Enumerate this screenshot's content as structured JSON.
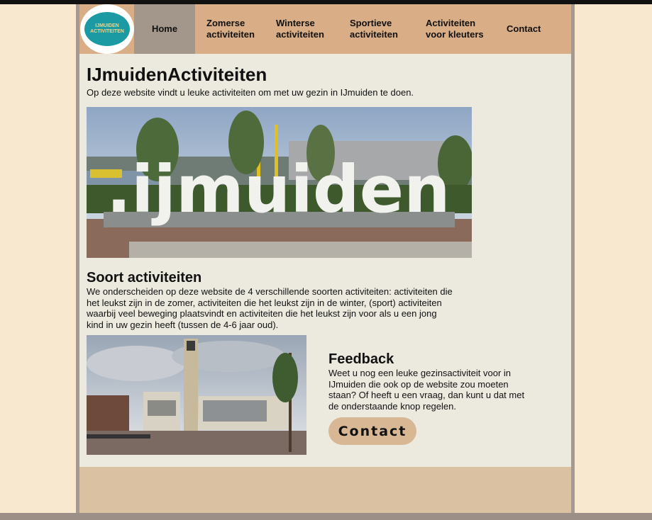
{
  "logo": {
    "line1": "IJMUIDEN",
    "line2": "ACTIVITEITEN"
  },
  "nav": {
    "items": [
      {
        "line1": "Home",
        "line2": ""
      },
      {
        "line1": "Zomerse",
        "line2": "activiteiten"
      },
      {
        "line1": "Winterse",
        "line2": "activiteiten"
      },
      {
        "line1": "Sportieve",
        "line2": "activiteiten"
      },
      {
        "line1": "Activiteiten",
        "line2": "voor kleuters"
      },
      {
        "line1": "Contact",
        "line2": ""
      }
    ]
  },
  "page": {
    "title": "IJmuidenActiviteiten",
    "intro": "Op deze website vindt u leuke activiteiten om met uw gezin in IJmuiden te doen.",
    "hero_sign": ".ijmuiden"
  },
  "section": {
    "title": "Soort activiteiten",
    "text": "We onderscheiden op deze website de 4 verschillende soorten activiteiten: activiteiten die het leukst zijn in de zomer, activiteiten die het leukst zijn in de winter, (sport) activiteiten waarbij veel beweging plaatsvindt en activiteiten die het leukst zijn voor als u een jong kind in uw gezin heeft (tussen de 4-6 jaar oud)."
  },
  "feedback": {
    "title": "Feedback",
    "text": "Weet u nog een leuke gezinsactiviteit voor in IJmuiden die ook op de website zou moeten staan? Of heeft u een vraag, dan kunt u dat met de onderstaande knop regelen.",
    "button_label": "Contact"
  }
}
